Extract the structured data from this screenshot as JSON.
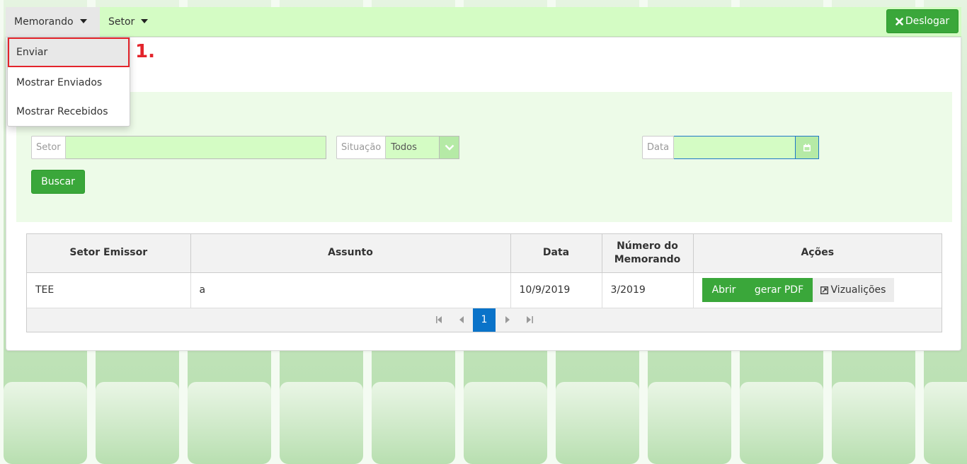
{
  "navbar": {
    "menu_memorando": "Memorando",
    "menu_setor": "Setor",
    "logout_label": "Deslogar",
    "logout_icon": "x-icon"
  },
  "dropdown": {
    "items": [
      "Enviar",
      "Mostrar Enviados",
      "Mostrar Recebidos"
    ],
    "annotation": "1."
  },
  "filters": {
    "setor_label": "Setor",
    "setor_value": "",
    "situacao_label": "Situação",
    "situacao_selected": "Todos",
    "data_label": "Data",
    "data_value": "",
    "search_label": "Buscar"
  },
  "table": {
    "headers": [
      "Setor Emissor",
      "Assunto",
      "Data",
      "Número do Memorando",
      "Ações"
    ],
    "rows": [
      {
        "setor_emissor": "TEE",
        "assunto": "a",
        "data": "10/9/2019",
        "numero": "3/2019"
      }
    ],
    "actions": {
      "open": "Abrir",
      "pdf": "gerar PDF",
      "views": "Vizualições"
    }
  },
  "pagination": {
    "current_page": "1"
  },
  "colors": {
    "accent": "#3aa73a",
    "nav_bg": "#d4fcc4",
    "annotation": "#e3242b",
    "page_active": "#0a73c9"
  }
}
